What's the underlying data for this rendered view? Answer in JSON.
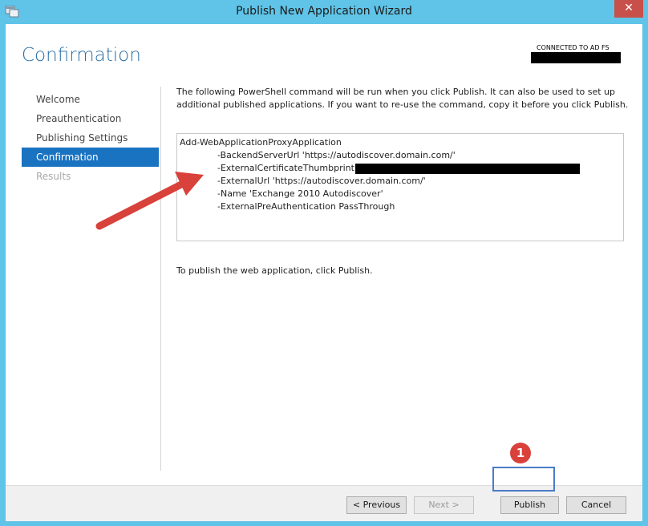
{
  "window": {
    "title": "Publish New Application Wizard",
    "close_label": "✕",
    "accent_color": "#5fc4e8"
  },
  "page": {
    "heading": "Confirmation",
    "server_label": "CONNECTED TO AD FS"
  },
  "nav": {
    "items": [
      {
        "label": "Welcome",
        "state": "normal"
      },
      {
        "label": "Preauthentication",
        "state": "normal"
      },
      {
        "label": "Publishing Settings",
        "state": "normal"
      },
      {
        "label": "Confirmation",
        "state": "active"
      },
      {
        "label": "Results",
        "state": "disabled"
      }
    ]
  },
  "main": {
    "intro": "The following PowerShell command will be run when you click Publish. It can also be used to set up additional published applications. If you want to re-use the command, copy it before you click Publish.",
    "command": {
      "cmdlet": "Add-WebApplicationProxyApplication",
      "params": [
        "-BackendServerUrl 'https://autodiscover.domain.com/'",
        "-ExternalCertificateThumbprint",
        "-ExternalUrl 'https://autodiscover.domain.com/'",
        "-Name 'Exchange 2010 Autodiscover'",
        "-ExternalPreAuthentication PassThrough"
      ]
    },
    "publish_instruction": "To publish the web application, click Publish."
  },
  "footer": {
    "previous_label": "< Previous",
    "next_label": "Next >",
    "publish_label": "Publish",
    "cancel_label": "Cancel"
  },
  "annotation": {
    "badge_number": "1",
    "arrow_color": "#d9413b"
  }
}
